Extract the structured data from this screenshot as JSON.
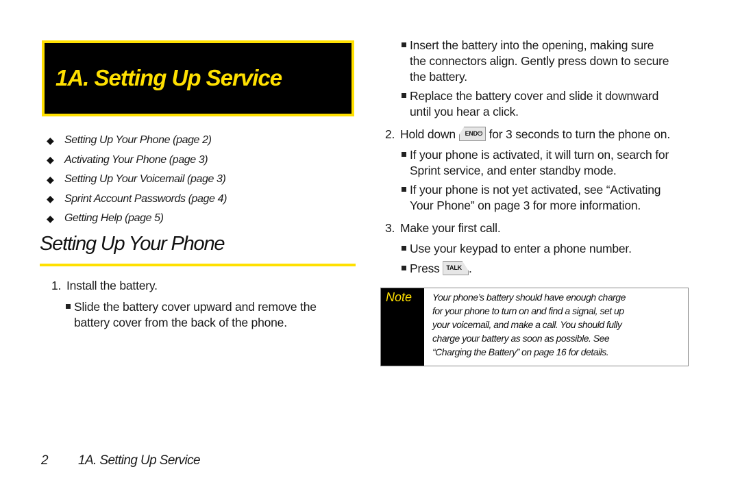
{
  "chapter": {
    "title": "1A. Setting Up Service",
    "accent_color": "#ffe000",
    "box_color": "#000000"
  },
  "toc": [
    {
      "icon": "diamond-bullet-icon",
      "label": "Setting Up Your Phone (page 2)"
    },
    {
      "icon": "diamond-bullet-icon",
      "label": "Activating Your Phone (page 3)"
    },
    {
      "icon": "diamond-bullet-icon",
      "label": "Setting Up Your Voicemail (page 3)"
    },
    {
      "icon": "diamond-bullet-icon",
      "label": "Sprint Account Passwords (page 4)"
    },
    {
      "icon": "diamond-bullet-icon",
      "label": "Getting Help (page 5)"
    }
  ],
  "section": {
    "title": "Setting Up Your Phone"
  },
  "steps": [
    {
      "number": "1.",
      "text": "Install the battery.",
      "bullets": [
        {
          "line1": "Slide the battery cover upward and remove the",
          "line2": "battery cover from the back of the phone."
        },
        {
          "line1": "Insert the battery into the opening, making sure",
          "line2": "the connectors align. Gently press down to secure",
          "line3": "the battery."
        },
        {
          "line1": "Replace the battery cover and slide it downward",
          "line2": "until you hear a click."
        }
      ]
    },
    {
      "number": "2.",
      "text_before": "Hold down",
      "key": "END⏻",
      "text_after": "for 3 seconds to turn the phone on.",
      "bullets": [
        {
          "line1": "If your phone is activated, it will turn on, search for",
          "line2": "Sprint service, and enter standby mode."
        },
        {
          "line1": "If your phone is not yet activated, see “Activating",
          "line2": "Your Phone” on page 3 for more information."
        }
      ]
    },
    {
      "number": "3.",
      "text": "Make your first call.",
      "bullets": [
        {
          "line1": "Use your keypad to enter a phone number."
        },
        {
          "line1": "Press",
          "key": "TALK",
          "after": "."
        }
      ]
    }
  ],
  "note": {
    "label": "Note",
    "lines": [
      "Your phone’s battery should have enough charge",
      "for your phone to turn on and find a signal, set up",
      "your voicemail, and make a call. You should fully",
      "charge your battery as soon as possible. See",
      "“Charging the Battery” on page 16 for details."
    ]
  },
  "footer": {
    "page_number": "2",
    "chapter": "1A. Setting Up Service"
  }
}
